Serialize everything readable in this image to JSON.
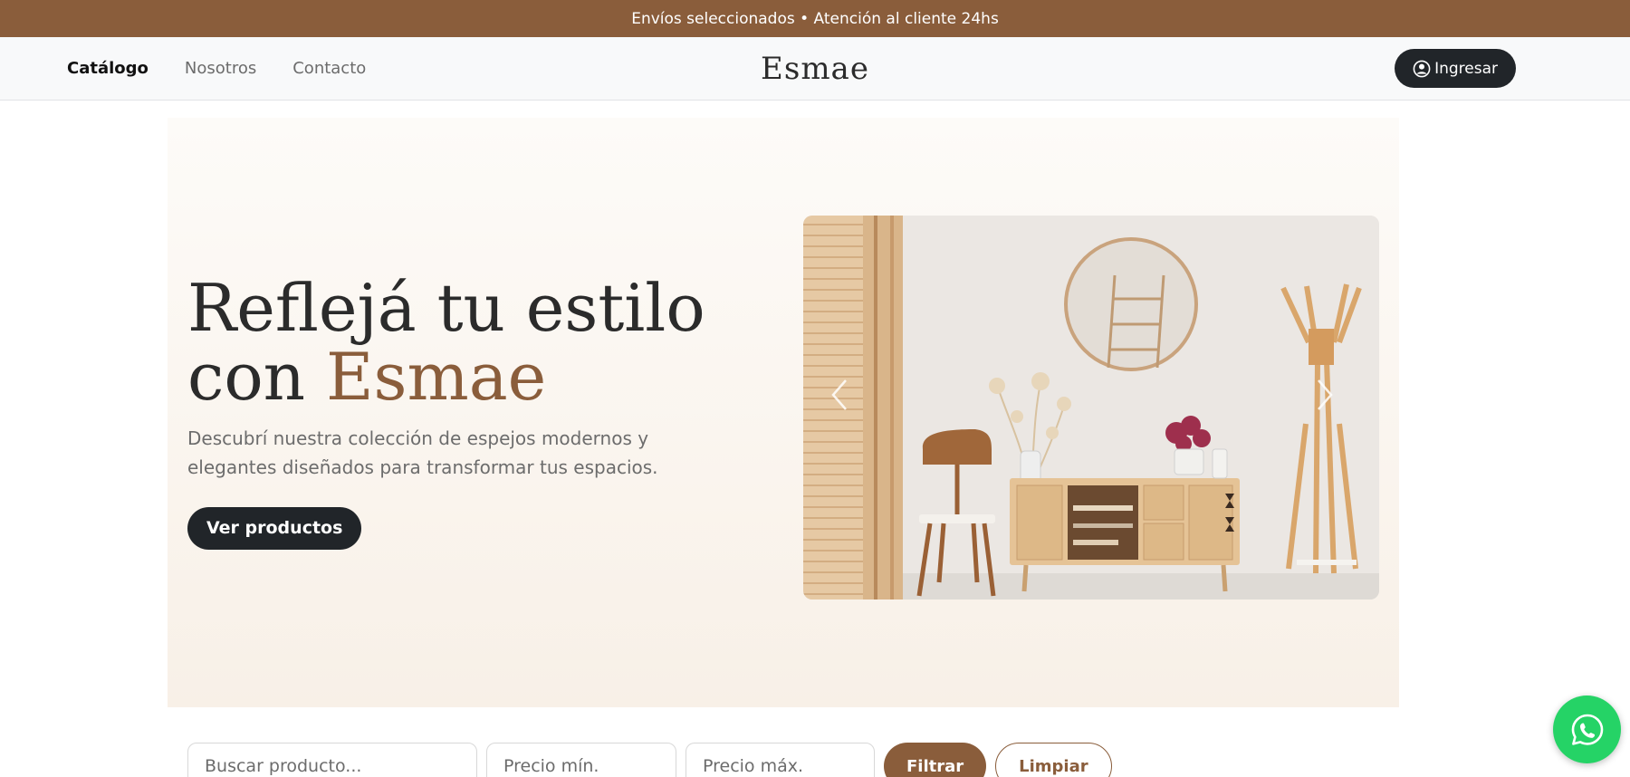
{
  "topbar": {
    "text": "Envíos seleccionados • Atención al cliente 24hs"
  },
  "nav": {
    "links": [
      {
        "label": "Catálogo",
        "active": true
      },
      {
        "label": "Nosotros",
        "active": false
      },
      {
        "label": "Contacto",
        "active": false
      }
    ],
    "brand": "Esmae",
    "login_label": "Ingresar",
    "login_icon": "user-circle-icon"
  },
  "hero": {
    "title_line1": "Reflejá tu estilo",
    "title_line2_prefix": "con ",
    "title_line2_accent": "Esmae",
    "subtitle": "Descubrí nuestra colección de espejos modernos y elegantes diseñados para transformar tus espacios.",
    "cta_label": "Ver productos",
    "carousel": {
      "prev_icon": "chevron-left-icon",
      "next_icon": "chevron-right-icon"
    }
  },
  "filters": {
    "search_placeholder": "Buscar producto...",
    "min_price_placeholder": "Precio mín.",
    "max_price_placeholder": "Precio máx.",
    "filter_label": "Filtrar",
    "clear_label": "Limpiar"
  },
  "whatsapp": {
    "icon": "whatsapp-icon"
  },
  "colors": {
    "brand_brown": "#8a5d3b",
    "dark": "#212529",
    "whatsapp_green": "#25d366",
    "hero_bg": "#f8f0e7"
  }
}
